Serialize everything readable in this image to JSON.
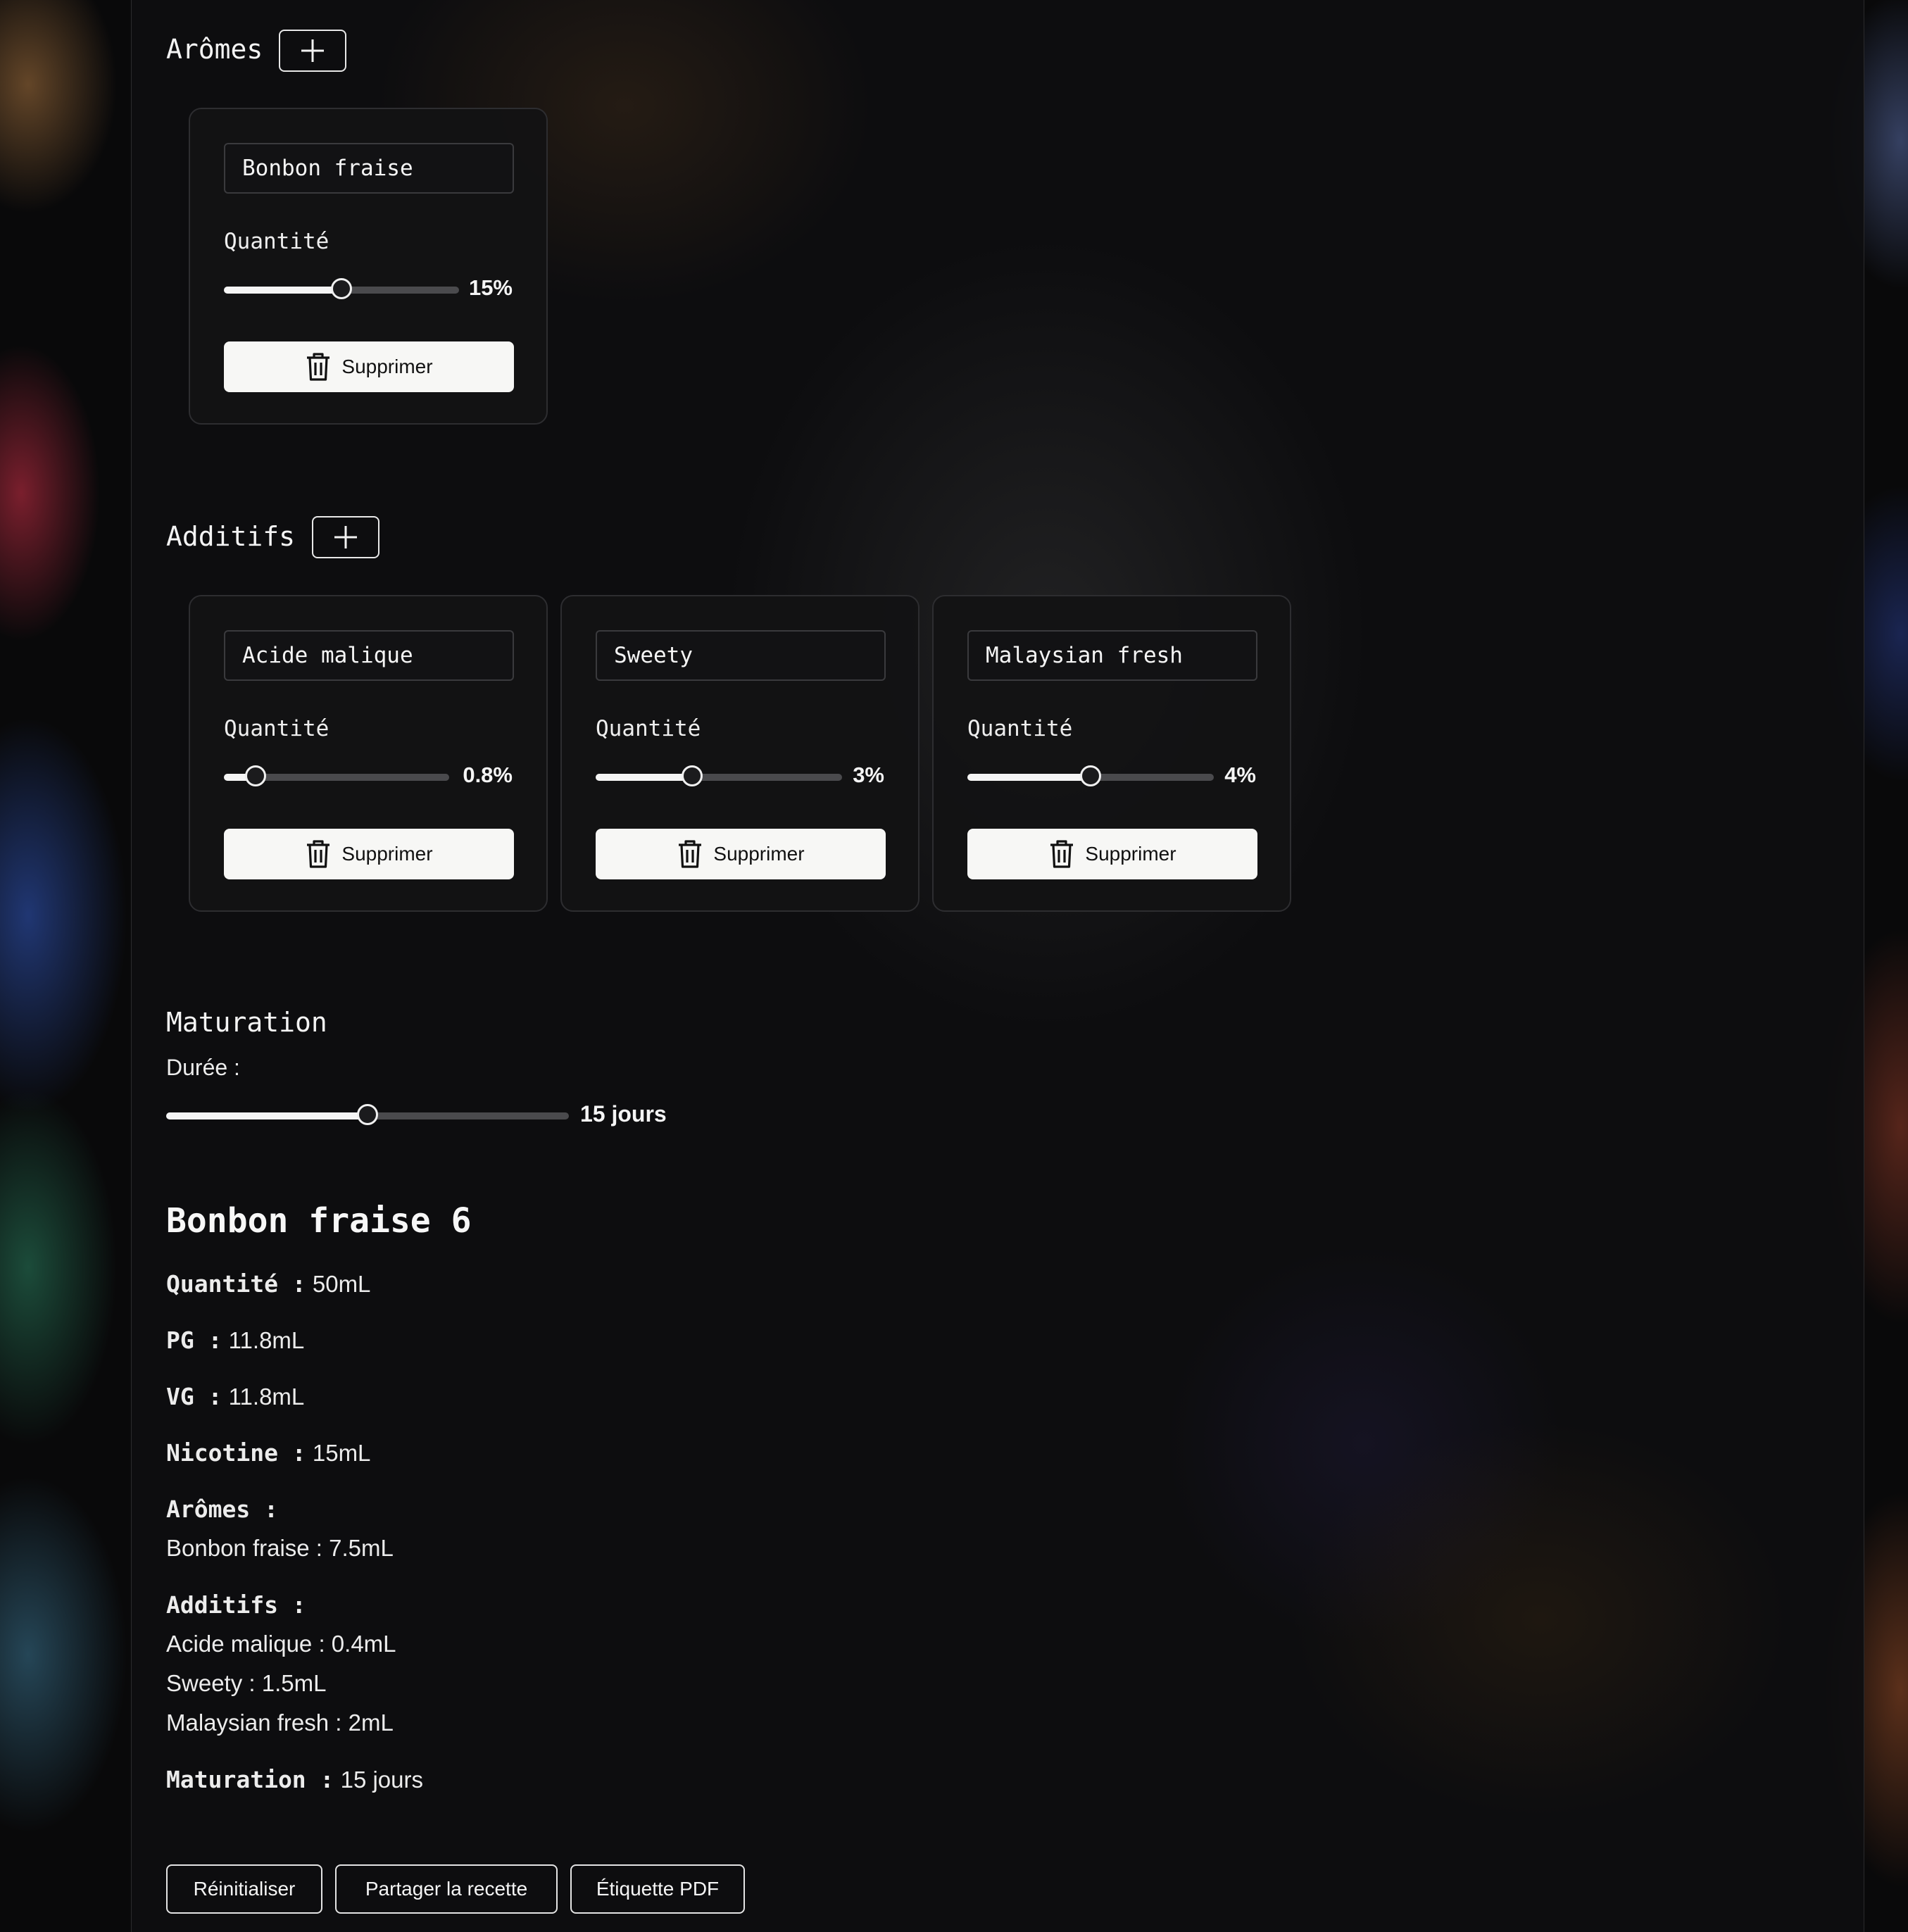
{
  "aromes": {
    "title": "Arômes",
    "items": [
      {
        "name": "Bonbon fraise",
        "qty_label": "Quantité",
        "value_label": "15%",
        "fraction": 0.5,
        "delete_label": "Supprimer"
      }
    ]
  },
  "additifs": {
    "title": "Additifs",
    "items": [
      {
        "name": "Acide malique",
        "qty_label": "Quantité",
        "value_label": "0.8%",
        "fraction": 0.14,
        "delete_label": "Supprimer"
      },
      {
        "name": "Sweety",
        "qty_label": "Quantité",
        "value_label": "3%",
        "fraction": 0.39,
        "delete_label": "Supprimer"
      },
      {
        "name": "Malaysian fresh",
        "qty_label": "Quantité",
        "value_label": "4%",
        "fraction": 0.5,
        "delete_label": "Supprimer"
      }
    ]
  },
  "maturation": {
    "title": "Maturation",
    "duration_label": "Durée :",
    "value_label": "15 jours",
    "fraction": 0.5
  },
  "summary": {
    "title": "Bonbon fraise 6",
    "quantite": {
      "key": "Quantité :",
      "value": "50mL"
    },
    "pg": {
      "key": "PG :",
      "value": "11.8mL"
    },
    "vg": {
      "key": "VG :",
      "value": "11.8mL"
    },
    "nicotine": {
      "key": "Nicotine :",
      "value": "15mL"
    },
    "aromes_heading": "Arômes :",
    "aromes": [
      {
        "name": "Bonbon fraise :",
        "value": "7.5mL"
      }
    ],
    "additifs_heading": "Additifs :",
    "additifs": [
      {
        "name": "Acide malique :",
        "value": "0.4mL"
      },
      {
        "name": "Sweety :",
        "value": "1.5mL"
      },
      {
        "name": "Malaysian fresh :",
        "value": "2mL"
      }
    ],
    "maturation": {
      "key": "Maturation :",
      "value": "15 jours"
    }
  },
  "actions": {
    "reset": "Réinitialiser",
    "share": "Partager la recette",
    "pdf": "Étiquette PDF"
  },
  "icons": {
    "add": "plus-icon",
    "delete": "trash-icon"
  }
}
